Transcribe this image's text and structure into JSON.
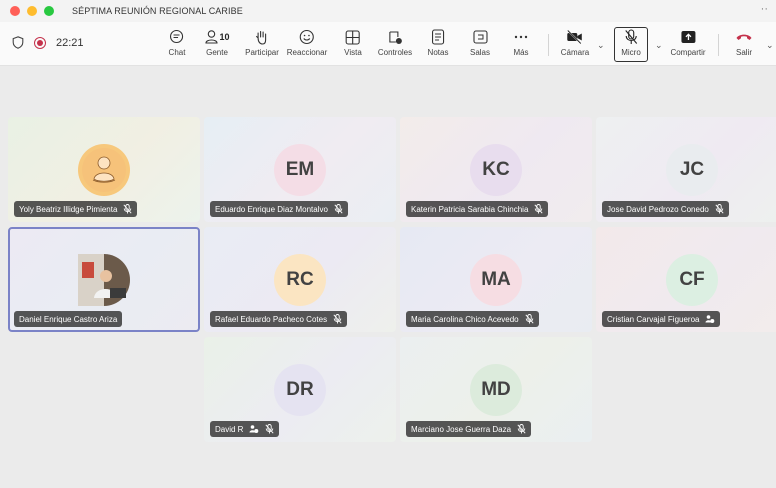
{
  "window": {
    "title": "SÉPTIMA REUNIÓN REGIONAL CARIBE",
    "more": "··"
  },
  "meeting": {
    "time": "22:21"
  },
  "toolbar": {
    "chat": "Chat",
    "people": "Gente",
    "people_count": "10",
    "raise": "Participar",
    "react": "Reaccionar",
    "view": "Vista",
    "controls": "Controles",
    "notes": "Notas",
    "rooms": "Salas",
    "more": "Más",
    "camera": "Cámara",
    "mic": "Micro",
    "share": "Compartir",
    "leave": "Salir"
  },
  "participants": [
    {
      "name": "Yoly Beatriz Illidge Pimienta",
      "initials": "",
      "avatar": "photo",
      "status": "muted"
    },
    {
      "name": "Eduardo Enrique Diaz Montalvo",
      "initials": "EM",
      "avatar": "initials",
      "status": "muted"
    },
    {
      "name": "Katerin Patricia Sarabia Chinchia",
      "initials": "KC",
      "avatar": "initials",
      "status": "muted"
    },
    {
      "name": "Jose David Pedrozo Conedo",
      "initials": "JC",
      "avatar": "initials",
      "status": "muted"
    },
    {
      "name": "Daniel Enrique Castro Ariza",
      "initials": "",
      "avatar": "photo",
      "status": "none",
      "active": true
    },
    {
      "name": "Rafael Eduardo Pacheco Cotes",
      "initials": "RC",
      "avatar": "initials",
      "status": "muted"
    },
    {
      "name": "Maria Carolina Chico Acevedo",
      "initials": "MA",
      "avatar": "initials",
      "status": "muted"
    },
    {
      "name": "Cristian Carvajal Figueroa",
      "initials": "CF",
      "avatar": "initials",
      "status": "guest"
    },
    {
      "name": "David R",
      "initials": "DR",
      "avatar": "initials",
      "status": "guest-muted"
    },
    {
      "name": "Marciano Jose Guerra Daza",
      "initials": "MD",
      "avatar": "initials",
      "status": "muted"
    }
  ],
  "colors": {
    "accent": "#5b5fc7",
    "leave": "#c4314b",
    "record": "#c4314b",
    "active_border": "#7b83c7",
    "initials_text": "#424242"
  }
}
